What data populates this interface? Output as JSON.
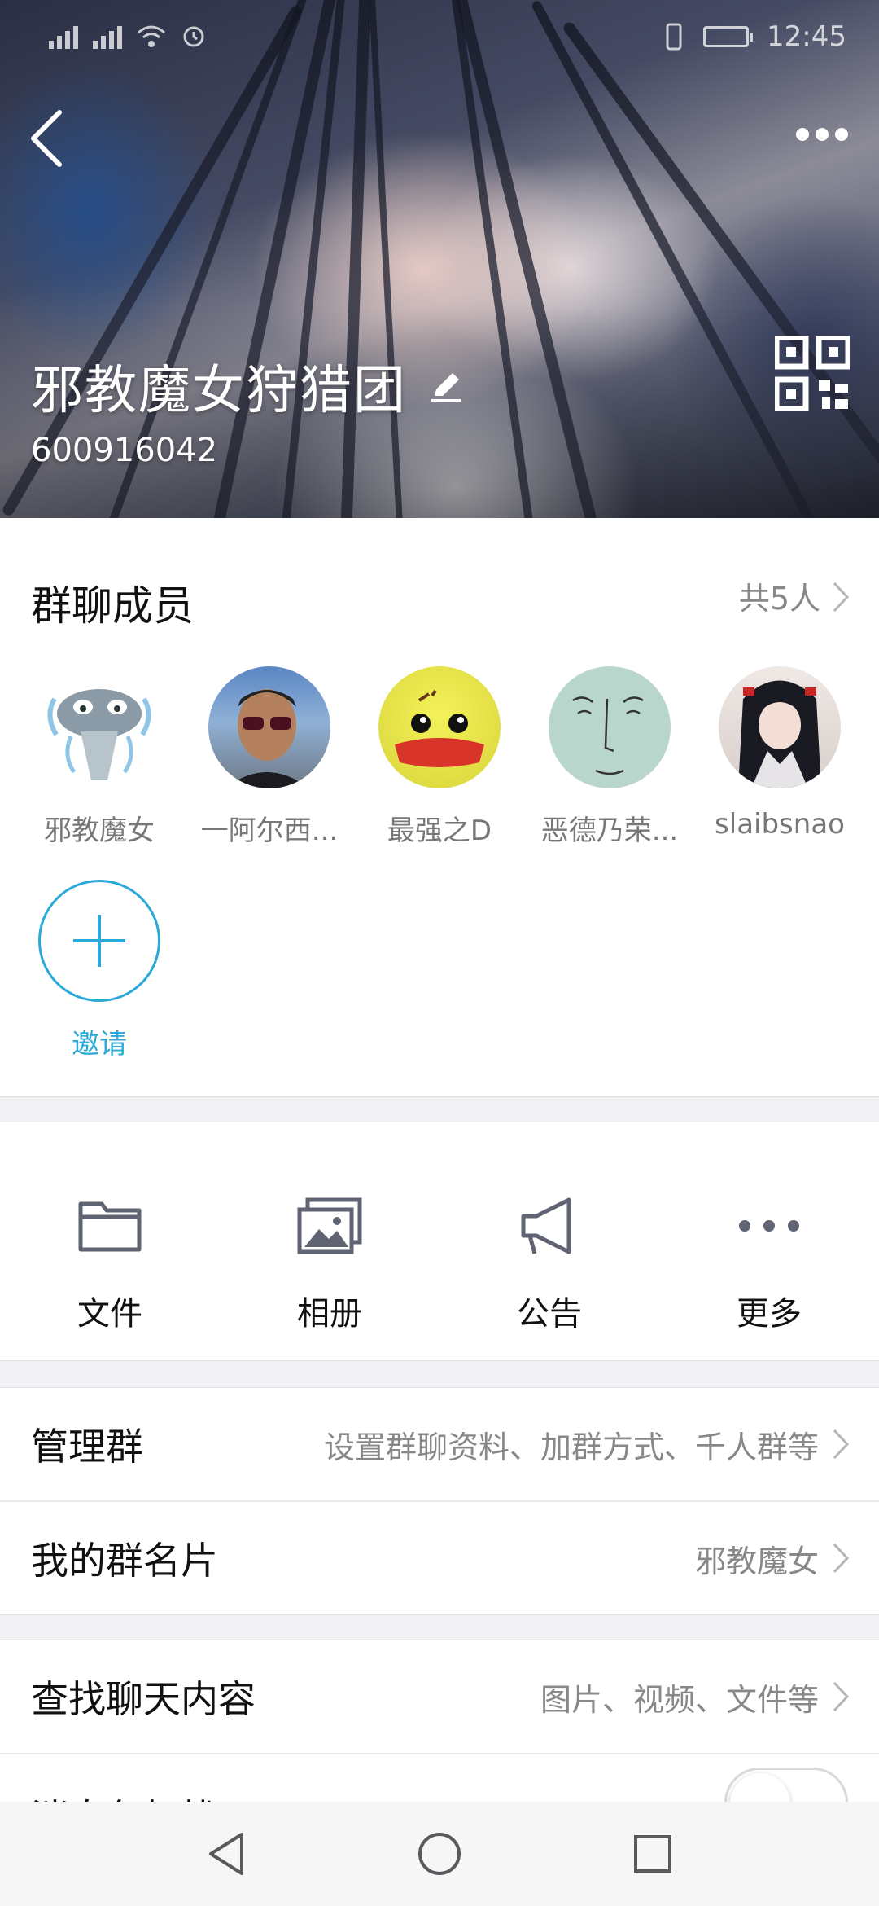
{
  "status_bar": {
    "time": "12:45"
  },
  "header": {
    "group_name": "邪教魔女狩猎团",
    "group_id": "600916042"
  },
  "members": {
    "title": "群聊成员",
    "count_label": "共5人",
    "items": [
      {
        "name": "邪教魔女"
      },
      {
        "name": "一阿尔西..."
      },
      {
        "name": "最强之D"
      },
      {
        "name": "恶德乃荣..."
      },
      {
        "name": "slaibsnao"
      }
    ],
    "invite_label": "邀请"
  },
  "tools": [
    {
      "label": "文件",
      "icon": "folder-icon"
    },
    {
      "label": "相册",
      "icon": "album-icon"
    },
    {
      "label": "公告",
      "icon": "megaphone-icon"
    },
    {
      "label": "更多",
      "icon": "more-dots-icon"
    }
  ],
  "settings": {
    "manage": {
      "label": "管理群",
      "value": "设置群聊资料、加群方式、千人群等"
    },
    "card": {
      "label": "我的群名片",
      "value": "邪教魔女"
    },
    "search": {
      "label": "查找聊天内容",
      "value": "图片、视频、文件等"
    },
    "mute": {
      "label": "消息免打扰"
    }
  },
  "colors": {
    "accent": "#2ba9d8",
    "secondary_text": "#888888",
    "band": "#f2f2f4"
  }
}
